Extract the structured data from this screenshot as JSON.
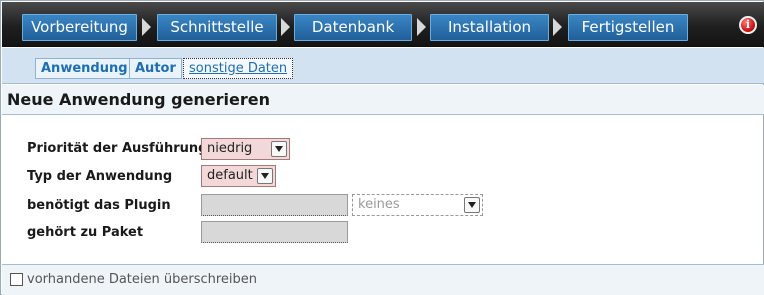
{
  "wizard": {
    "steps": [
      "Vorbereitung",
      "Schnittstelle",
      "Datenbank",
      "Installation",
      "Fertigstellen"
    ],
    "alert_icon": "info-alert-icon"
  },
  "tabs": {
    "items": [
      "Anwendung",
      "Autor",
      "sonstige Daten"
    ],
    "active": "sonstige Daten"
  },
  "page": {
    "title": "Neue Anwendung generieren"
  },
  "form": {
    "priority_label": "Priorität der Ausführung",
    "priority_value": "niedrig",
    "type_label": "Typ der Anwendung",
    "type_value": "default",
    "plugin_label": "benötigt das Plugin",
    "plugin_value": "",
    "plugin_select_value": "keines",
    "package_label": "gehört zu Paket",
    "package_value": ""
  },
  "footer": {
    "overwrite_label": "vorhandene Dateien überschreiben",
    "overwrite_checked": false
  },
  "colors": {
    "step_blue": "#2a70ae",
    "tab_text": "#1d6fb3",
    "select_bg": "#f2d8d8"
  }
}
